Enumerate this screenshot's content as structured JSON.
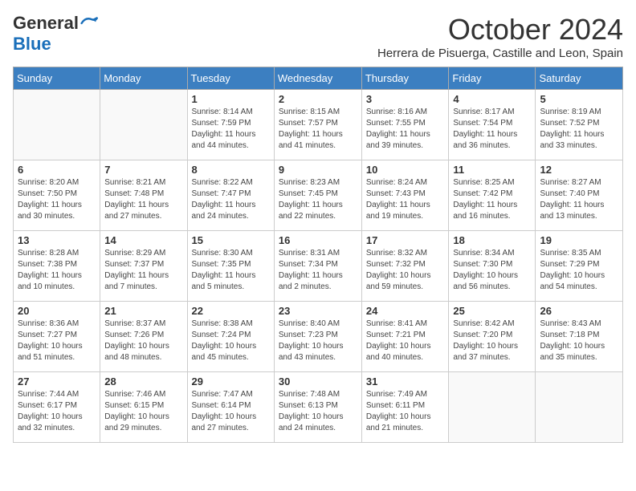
{
  "logo": {
    "general": "General",
    "blue": "Blue"
  },
  "title": "October 2024",
  "subtitle": "Herrera de Pisuerga, Castille and Leon, Spain",
  "days": [
    "Sunday",
    "Monday",
    "Tuesday",
    "Wednesday",
    "Thursday",
    "Friday",
    "Saturday"
  ],
  "weeks": [
    [
      {
        "day": "",
        "info": ""
      },
      {
        "day": "",
        "info": ""
      },
      {
        "day": "1",
        "info": "Sunrise: 8:14 AM\nSunset: 7:59 PM\nDaylight: 11 hours and 44 minutes."
      },
      {
        "day": "2",
        "info": "Sunrise: 8:15 AM\nSunset: 7:57 PM\nDaylight: 11 hours and 41 minutes."
      },
      {
        "day": "3",
        "info": "Sunrise: 8:16 AM\nSunset: 7:55 PM\nDaylight: 11 hours and 39 minutes."
      },
      {
        "day": "4",
        "info": "Sunrise: 8:17 AM\nSunset: 7:54 PM\nDaylight: 11 hours and 36 minutes."
      },
      {
        "day": "5",
        "info": "Sunrise: 8:19 AM\nSunset: 7:52 PM\nDaylight: 11 hours and 33 minutes."
      }
    ],
    [
      {
        "day": "6",
        "info": "Sunrise: 8:20 AM\nSunset: 7:50 PM\nDaylight: 11 hours and 30 minutes."
      },
      {
        "day": "7",
        "info": "Sunrise: 8:21 AM\nSunset: 7:48 PM\nDaylight: 11 hours and 27 minutes."
      },
      {
        "day": "8",
        "info": "Sunrise: 8:22 AM\nSunset: 7:47 PM\nDaylight: 11 hours and 24 minutes."
      },
      {
        "day": "9",
        "info": "Sunrise: 8:23 AM\nSunset: 7:45 PM\nDaylight: 11 hours and 22 minutes."
      },
      {
        "day": "10",
        "info": "Sunrise: 8:24 AM\nSunset: 7:43 PM\nDaylight: 11 hours and 19 minutes."
      },
      {
        "day": "11",
        "info": "Sunrise: 8:25 AM\nSunset: 7:42 PM\nDaylight: 11 hours and 16 minutes."
      },
      {
        "day": "12",
        "info": "Sunrise: 8:27 AM\nSunset: 7:40 PM\nDaylight: 11 hours and 13 minutes."
      }
    ],
    [
      {
        "day": "13",
        "info": "Sunrise: 8:28 AM\nSunset: 7:38 PM\nDaylight: 11 hours and 10 minutes."
      },
      {
        "day": "14",
        "info": "Sunrise: 8:29 AM\nSunset: 7:37 PM\nDaylight: 11 hours and 7 minutes."
      },
      {
        "day": "15",
        "info": "Sunrise: 8:30 AM\nSunset: 7:35 PM\nDaylight: 11 hours and 5 minutes."
      },
      {
        "day": "16",
        "info": "Sunrise: 8:31 AM\nSunset: 7:34 PM\nDaylight: 11 hours and 2 minutes."
      },
      {
        "day": "17",
        "info": "Sunrise: 8:32 AM\nSunset: 7:32 PM\nDaylight: 10 hours and 59 minutes."
      },
      {
        "day": "18",
        "info": "Sunrise: 8:34 AM\nSunset: 7:30 PM\nDaylight: 10 hours and 56 minutes."
      },
      {
        "day": "19",
        "info": "Sunrise: 8:35 AM\nSunset: 7:29 PM\nDaylight: 10 hours and 54 minutes."
      }
    ],
    [
      {
        "day": "20",
        "info": "Sunrise: 8:36 AM\nSunset: 7:27 PM\nDaylight: 10 hours and 51 minutes."
      },
      {
        "day": "21",
        "info": "Sunrise: 8:37 AM\nSunset: 7:26 PM\nDaylight: 10 hours and 48 minutes."
      },
      {
        "day": "22",
        "info": "Sunrise: 8:38 AM\nSunset: 7:24 PM\nDaylight: 10 hours and 45 minutes."
      },
      {
        "day": "23",
        "info": "Sunrise: 8:40 AM\nSunset: 7:23 PM\nDaylight: 10 hours and 43 minutes."
      },
      {
        "day": "24",
        "info": "Sunrise: 8:41 AM\nSunset: 7:21 PM\nDaylight: 10 hours and 40 minutes."
      },
      {
        "day": "25",
        "info": "Sunrise: 8:42 AM\nSunset: 7:20 PM\nDaylight: 10 hours and 37 minutes."
      },
      {
        "day": "26",
        "info": "Sunrise: 8:43 AM\nSunset: 7:18 PM\nDaylight: 10 hours and 35 minutes."
      }
    ],
    [
      {
        "day": "27",
        "info": "Sunrise: 7:44 AM\nSunset: 6:17 PM\nDaylight: 10 hours and 32 minutes."
      },
      {
        "day": "28",
        "info": "Sunrise: 7:46 AM\nSunset: 6:15 PM\nDaylight: 10 hours and 29 minutes."
      },
      {
        "day": "29",
        "info": "Sunrise: 7:47 AM\nSunset: 6:14 PM\nDaylight: 10 hours and 27 minutes."
      },
      {
        "day": "30",
        "info": "Sunrise: 7:48 AM\nSunset: 6:13 PM\nDaylight: 10 hours and 24 minutes."
      },
      {
        "day": "31",
        "info": "Sunrise: 7:49 AM\nSunset: 6:11 PM\nDaylight: 10 hours and 21 minutes."
      },
      {
        "day": "",
        "info": ""
      },
      {
        "day": "",
        "info": ""
      }
    ]
  ]
}
